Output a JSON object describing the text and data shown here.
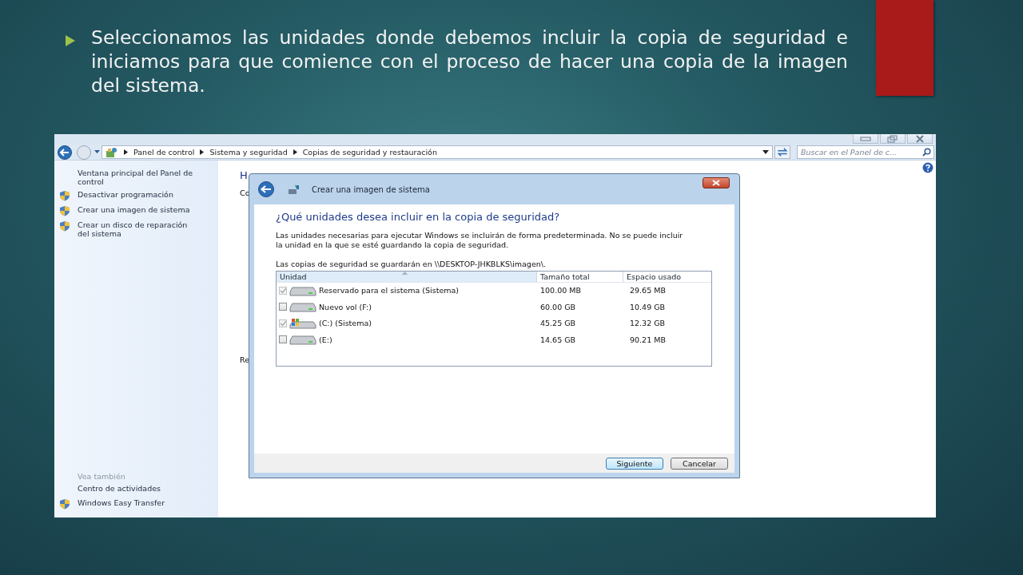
{
  "slide": {
    "bullet_text": "Seleccionamos las unidades donde debemos incluir la copia de seguridad e iniciamos para que comience con el proceso de hacer una copia de la imagen del sistema."
  },
  "window": {
    "breadcrumb": [
      "Panel de control",
      "Sistema y seguridad",
      "Copias de seguridad y restauración"
    ],
    "search": {
      "placeholder": "Buscar en el Panel de c..."
    },
    "sidebar": {
      "tasks": [
        {
          "label": "Ventana principal del Panel de control",
          "shield": false
        },
        {
          "label": "Desactivar programación",
          "shield": true
        },
        {
          "label": "Crear una imagen de sistema",
          "shield": true
        },
        {
          "label": "Crear un disco de reparación del sistema",
          "shield": true
        }
      ],
      "see_also_title": "Vea también",
      "see_also": [
        {
          "label": "Centro de actividades",
          "shield": false
        },
        {
          "label": "Windows Easy Transfer",
          "shield": true
        }
      ]
    },
    "main": {
      "heading": "H",
      "lines": [
        "Co",
        "Re"
      ]
    }
  },
  "dialog": {
    "title": "Crear una imagen de sistema",
    "heading": "¿Qué unidades desea incluir en la copia de seguridad?",
    "description": "Las unidades necesarias para ejecutar Windows se incluirán de forma predeterminada. No se puede incluir la unidad en la que se esté guardando la copia de seguridad.",
    "destination": "Las copias de seguridad se guardarán en \\\\DESKTOP-JHKBLKS\\imagen\\.",
    "columns": [
      "Unidad",
      "Tamaño total",
      "Espacio usado"
    ],
    "rows": [
      {
        "name": "Reservado para el sistema (Sistema)",
        "size": "100.00 MB",
        "used": "29.65 MB",
        "checked": true,
        "disabled": true,
        "kind": "drive"
      },
      {
        "name": "Nuevo vol (F:)",
        "size": "60.00 GB",
        "used": "10.49 GB",
        "checked": false,
        "disabled": false,
        "kind": "drive"
      },
      {
        "name": "(C:) (Sistema)",
        "size": "45.25 GB",
        "used": "12.32 GB",
        "checked": true,
        "disabled": true,
        "kind": "system"
      },
      {
        "name": "(E:)",
        "size": "14.65 GB",
        "used": "90.21 MB",
        "checked": false,
        "disabled": false,
        "kind": "drive"
      }
    ],
    "buttons": [
      {
        "label": "Siguiente",
        "default": true
      },
      {
        "label": "Cancelar",
        "default": false
      }
    ]
  }
}
